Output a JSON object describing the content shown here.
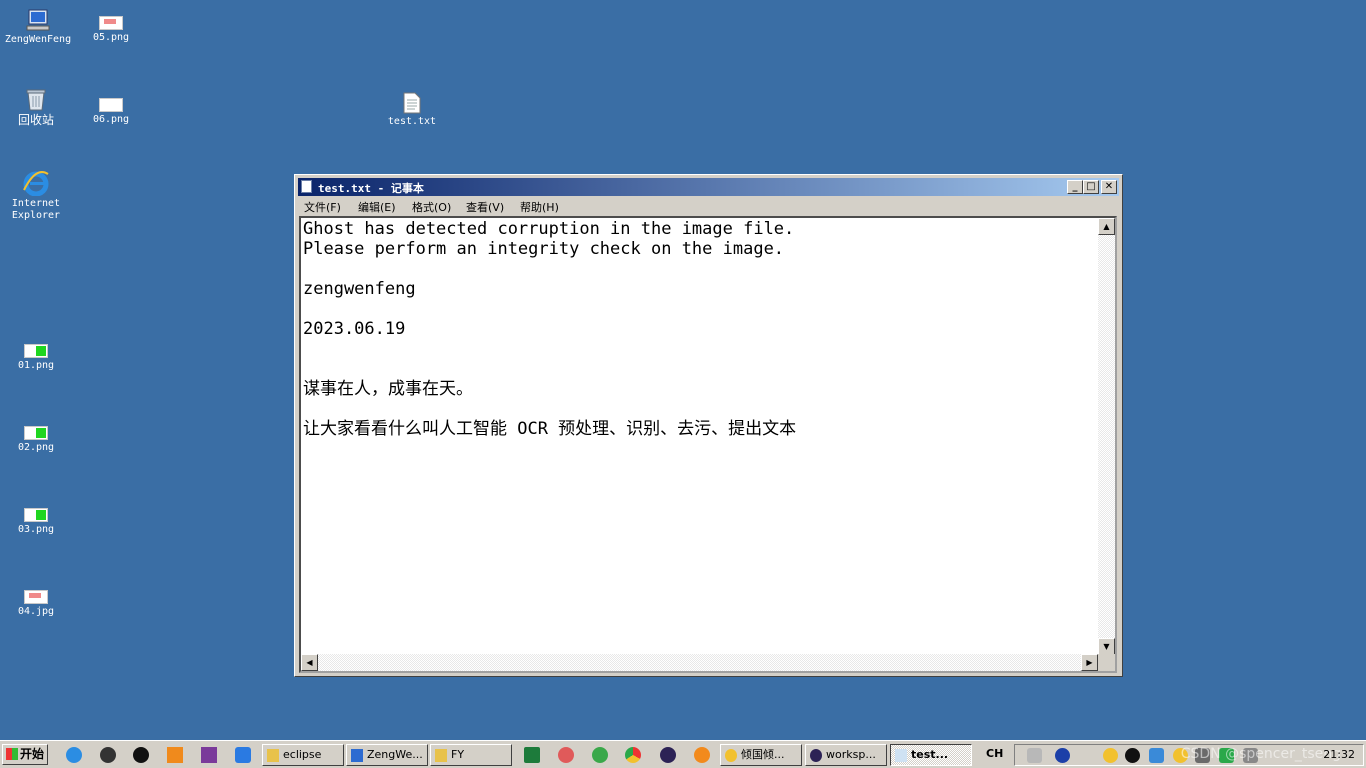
{
  "desktop": {
    "icons": [
      {
        "label": "ZengWenFeng"
      },
      {
        "label": "05.png"
      },
      {
        "label": "回收站"
      },
      {
        "label": "06.png"
      },
      {
        "label": "test.txt"
      },
      {
        "label": "Internet Explorer"
      },
      {
        "label": "01.png"
      },
      {
        "label": "02.png"
      },
      {
        "label": "03.png"
      },
      {
        "label": "04.jpg"
      }
    ]
  },
  "notepad": {
    "title": "test.txt - 记事本",
    "menu": [
      "文件(F)",
      "编辑(E)",
      "格式(O)",
      "查看(V)",
      "帮助(H)"
    ],
    "content": "Ghost has detected corruption in the image file.\nPlease perform an integrity check on the image.\n\nzengwenfeng\n\n2023.06.19\n\n\n谋事在人，成事在天。\n\n让大家看看什么叫人工智能 OCR 预处理、识别、去污、提出文本"
  },
  "taskbar": {
    "start_label": "开始",
    "tasks": [
      "eclipse",
      "ZengWe...",
      "FY",
      "倾国倾...",
      "worksp...",
      "test..."
    ],
    "ime": "CH",
    "clock": "21:32"
  },
  "watermark": "CSDN @spencer_tseng"
}
